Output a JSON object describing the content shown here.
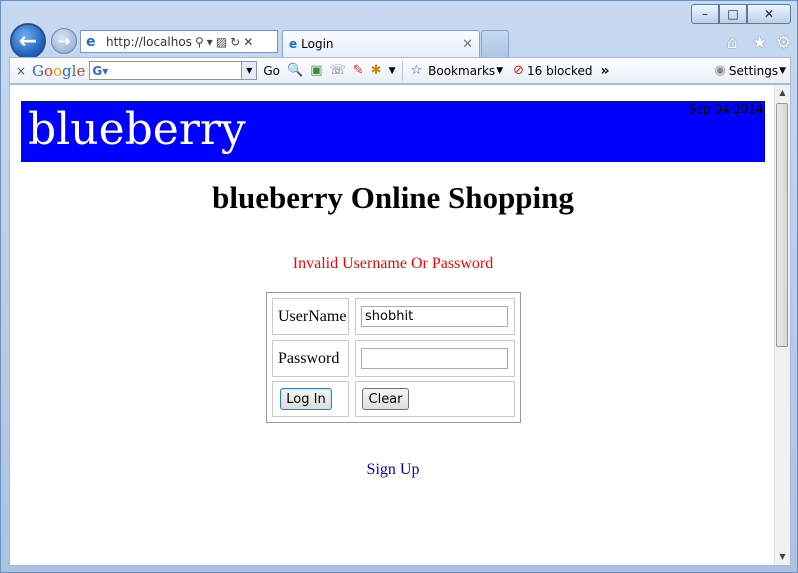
{
  "browser": {
    "address_url": "http://localhost:",
    "tab_title": "Login",
    "window_buttons": {
      "minimize": "–",
      "maximize": "□",
      "close": "✕"
    }
  },
  "toolbar": {
    "go_label": "Go",
    "bookmarks_label": "Bookmarks",
    "blocked_label": "16 blocked",
    "settings_label": "Settings",
    "more_label": "»"
  },
  "page": {
    "brand": "blueberry",
    "date": "Sep 04 2014",
    "heading": "blueberry Online Shopping",
    "error_message": "Invalid Username Or Password",
    "username_label": "UserName",
    "username_value": "shobhit",
    "password_label": "Password",
    "password_value": "",
    "login_button": "Log In",
    "clear_button": "Clear",
    "signup_link": "Sign Up"
  },
  "colors": {
    "banner_bg": "#0000ff",
    "error_text": "#ff0000",
    "link": "#0000cc"
  }
}
